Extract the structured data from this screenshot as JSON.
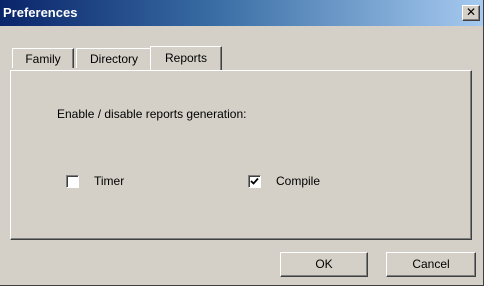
{
  "window": {
    "title": "Preferences",
    "close_glyph": "✕"
  },
  "tabs": [
    {
      "label": "Family"
    },
    {
      "label": "Directory"
    },
    {
      "label": "Reports",
      "active": true
    }
  ],
  "reports": {
    "heading": "Enable / disable reports generation:",
    "timer": {
      "label": "Timer",
      "checked": false
    },
    "compile": {
      "label": "Compile",
      "checked": true
    }
  },
  "buttons": {
    "ok": "OK",
    "cancel": "Cancel"
  }
}
